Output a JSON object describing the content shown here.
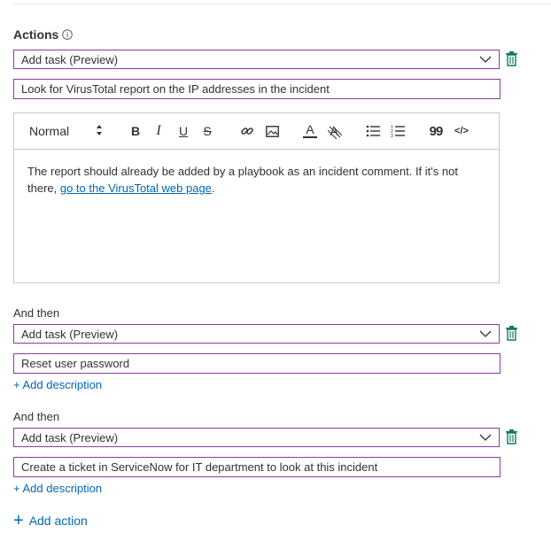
{
  "actions": {
    "title": "Actions",
    "info_icon": "info-icon",
    "first": {
      "select_value": "Add task (Preview)",
      "task_title": "Look for VirusTotal report on the IP addresses in the incident",
      "editor": {
        "format": "Normal",
        "toolbar_icons": [
          "bold-icon",
          "italic-icon",
          "underline-icon",
          "strikethrough-icon",
          "link-icon",
          "image-icon",
          "font-color-icon",
          "highlight-icon",
          "bullet-list-icon",
          "numbered-list-icon",
          "quote-icon",
          "code-icon"
        ],
        "toolbar_glyphs": {
          "bold": "B",
          "italic": "I",
          "underline": "U",
          "strike": "S",
          "font_color": "A",
          "highlight": "A",
          "quote": "99",
          "code": "</>"
        },
        "body_text": "The report should already be added by a playbook as an incident comment. If it's not there, ",
        "body_link": "go to the VirusTotal web page",
        "body_end": "."
      }
    },
    "second": {
      "label": "And then",
      "select_value": "Add task (Preview)",
      "task_title": "Reset user password",
      "add_description": "+ Add description"
    },
    "third": {
      "label": "And then",
      "select_value": "Add task (Preview)",
      "task_title": "Create a ticket in ServiceNow for IT department to look at this incident",
      "add_description": "+ Add description"
    },
    "add_action": {
      "plus": "+",
      "label": "Add action"
    }
  },
  "colors": {
    "accent_border": "#8a3d9f",
    "link": "#0067b8",
    "trash": "#0f7b5f"
  }
}
